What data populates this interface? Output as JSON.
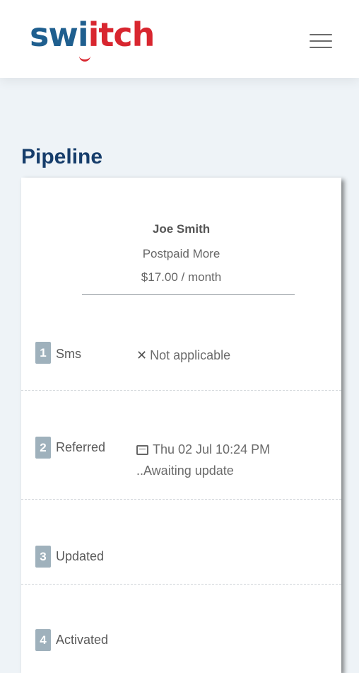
{
  "header": {
    "logo": {
      "part1": "swi",
      "part2": "itch"
    }
  },
  "page": {
    "title": "Pipeline"
  },
  "summary": {
    "customer_name": "Joe Smith",
    "plan": "Postpaid More",
    "price": "$17.00 / month"
  },
  "steps": [
    {
      "number": "1",
      "label": "Sms",
      "status_icon": "x-icon",
      "status_symbol": "✕",
      "status": "Not applicable"
    },
    {
      "number": "2",
      "label": "Referred",
      "status_icon": "calendar-icon",
      "status": "Thu 02 Jul 10:24 PM",
      "substatus": "..Awaiting update"
    },
    {
      "number": "3",
      "label": "Updated"
    },
    {
      "number": "4",
      "label": "Activated"
    }
  ],
  "colors": {
    "brand_blue": "#1f5f8f",
    "brand_red": "#d8262f",
    "title": "#163d6b",
    "step_badge": "#9fb1bc",
    "background": "#eef3f7"
  }
}
